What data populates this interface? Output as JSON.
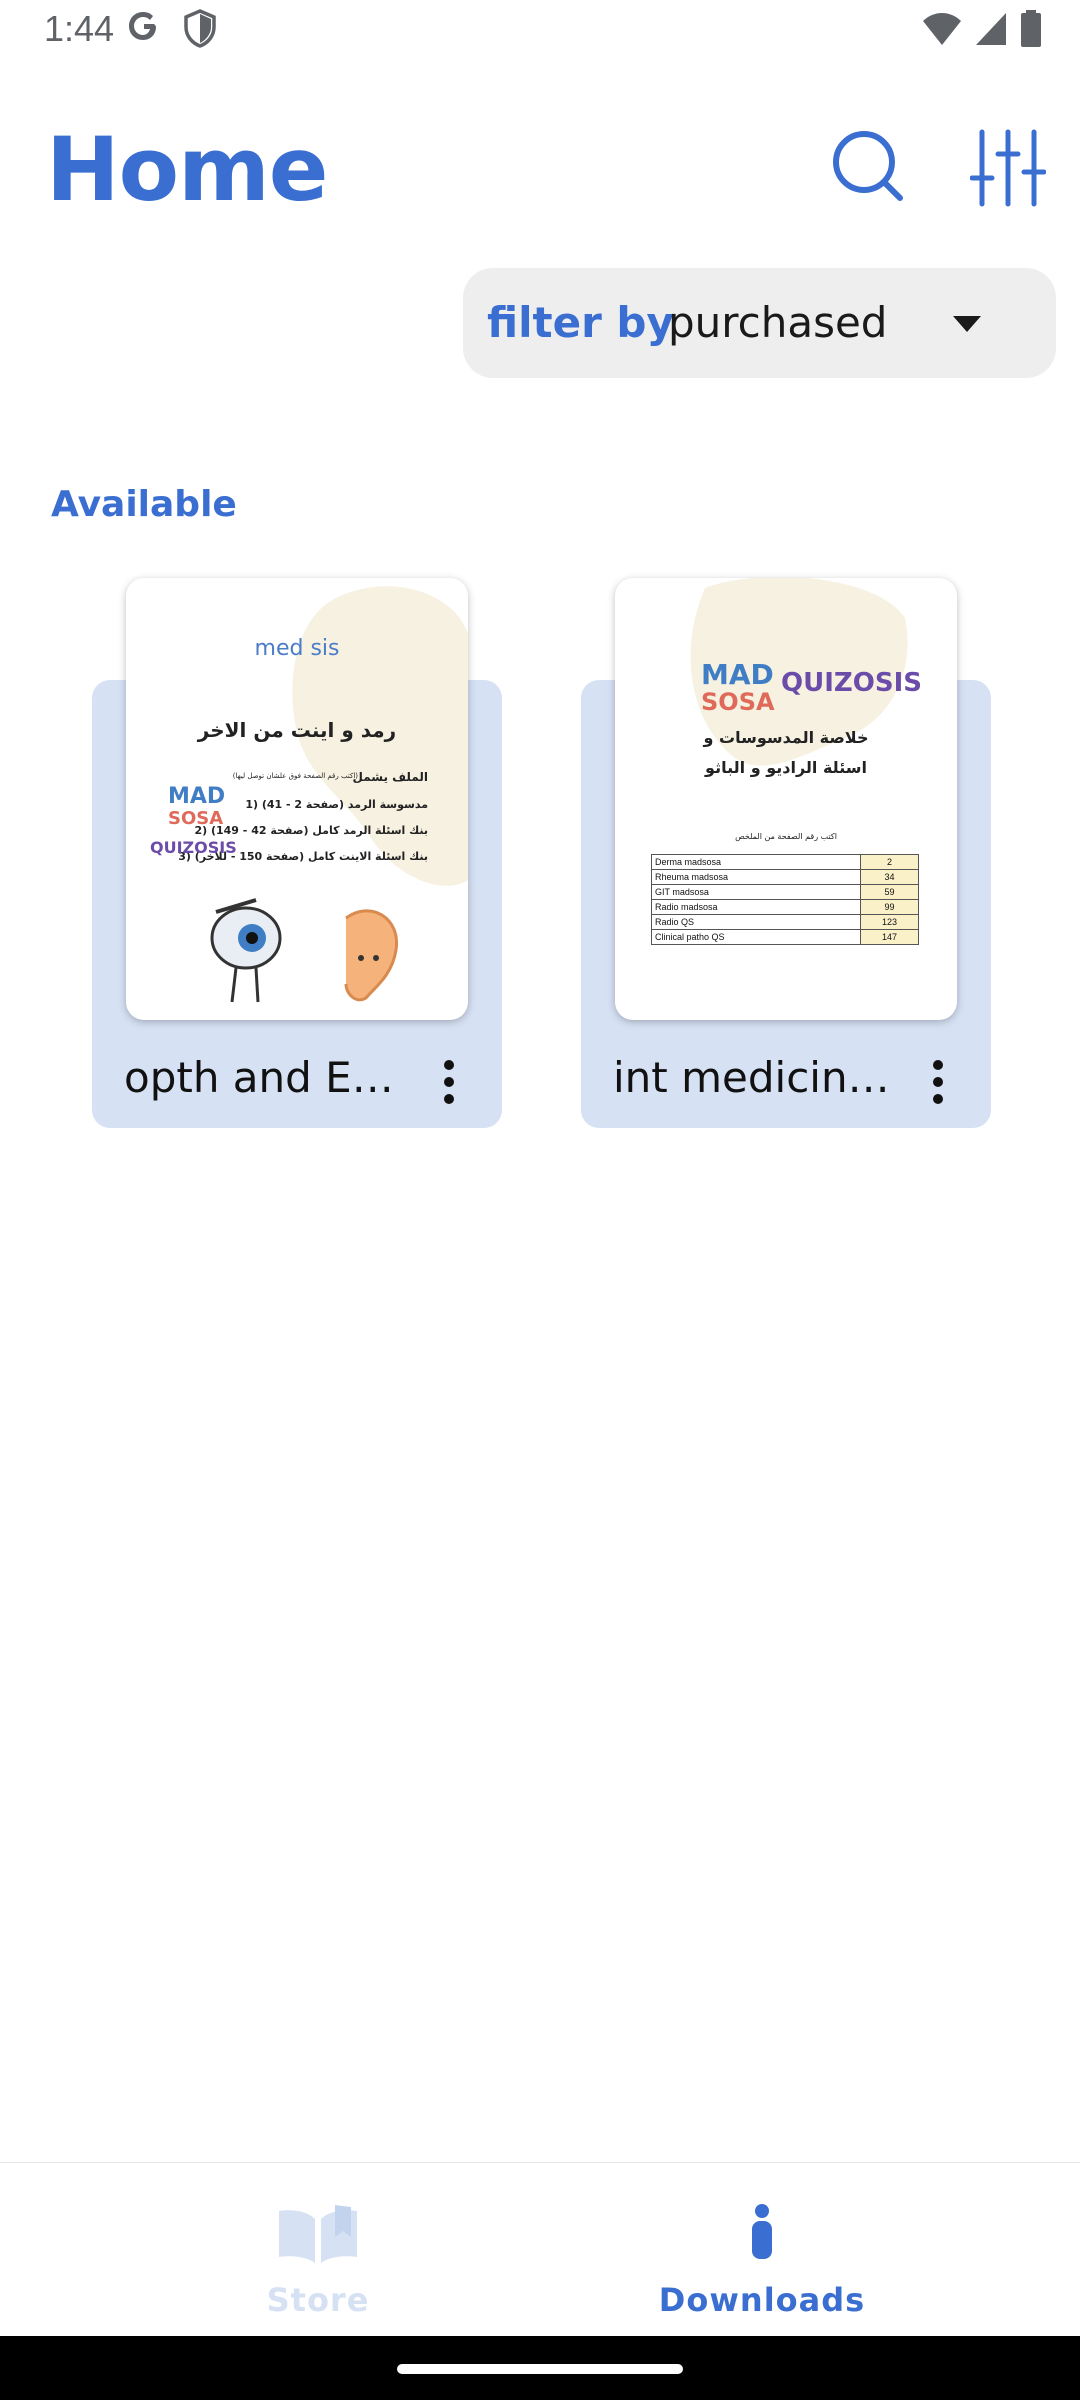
{
  "status": {
    "time": "1:44"
  },
  "header": {
    "title": "Home"
  },
  "filter": {
    "label": "filter by",
    "value": "purchased"
  },
  "section": {
    "label": "Available"
  },
  "cards": [
    {
      "title": "opth and EN...",
      "cover": {
        "brand": "med  sis",
        "heading": "رمد و اينت من الاخر",
        "includes": "الملف يشمل",
        "note": "(اكتب رقم الصفحة فوق علشان توصل ليها)",
        "line1": "1) مدسوسة الرمد (صفحة 2 - 41)",
        "line2": "2) بنك اسئلة الرمد كامل (صفحة 42 - 149)",
        "line3": "3) بنك اسئلة الاينت كامل (صفحة 150 - للاخر)",
        "logo1": "MAD",
        "logo2": "SOSA",
        "logo3": "QUIZOSIS"
      }
    },
    {
      "title": "int medicine ...",
      "cover": {
        "logo1": "MAD",
        "logo2": "SOSA",
        "logo3": "QUIZOSIS",
        "heading1": "خلاصة المدسوسات و",
        "heading2": "اسئلة الراديو و الباثو",
        "table_caption": "اكتب رقم الصفحة من الملخص",
        "rows": [
          {
            "name": "Derma madsosa",
            "page": "2"
          },
          {
            "name": "Rheuma madsosa",
            "page": "34"
          },
          {
            "name": "GIT madsosa",
            "page": "59"
          },
          {
            "name": "Radio madsosa",
            "page": "99"
          },
          {
            "name": "Radio QS",
            "page": "123"
          },
          {
            "name": "Clinical patho QS",
            "page": "147"
          }
        ]
      }
    }
  ],
  "bottom_nav": [
    {
      "label": "Store",
      "active": false
    },
    {
      "label": "Downloads",
      "active": true
    }
  ],
  "colors": {
    "accent": "#3a6fd1",
    "card_bg": "#d6e1f4",
    "inactive": "#d6e1f4"
  }
}
